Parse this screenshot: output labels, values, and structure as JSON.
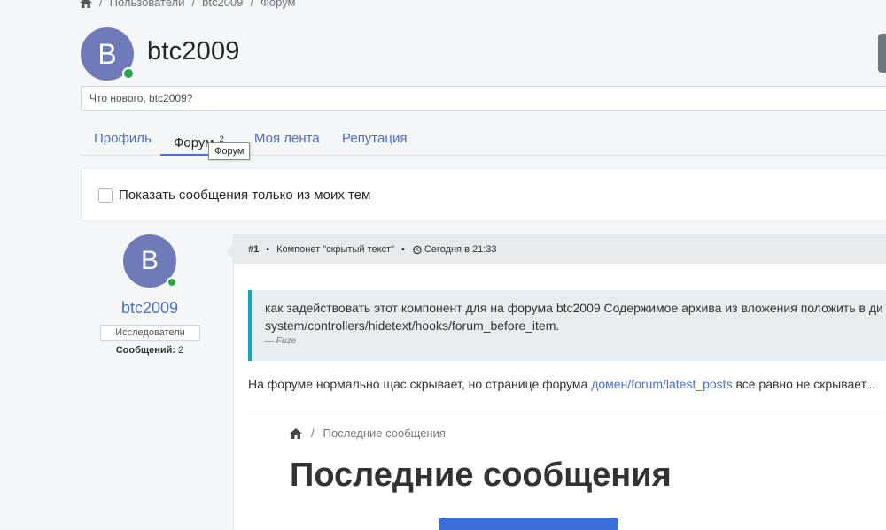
{
  "breadcrumb": {
    "home_icon": "home-icon",
    "items": [
      "Пользователи",
      "btc2009",
      "Форум"
    ]
  },
  "profile": {
    "avatar_letter": "B",
    "name": "btc2009",
    "status_placeholder": "Что нового, btc2009?"
  },
  "tabs": [
    {
      "label": "Профиль"
    },
    {
      "label": "Форум",
      "count": "2"
    },
    {
      "label": "Моя лента"
    },
    {
      "label": "Репутация"
    }
  ],
  "tooltip": "Форум",
  "filter": {
    "label": "Показать сообщения только из моих тем",
    "checked": false
  },
  "poster": {
    "avatar_letter": "B",
    "name": "btc2009",
    "group": "Исследователи",
    "messages_label": "Сообщений:",
    "messages_count": "2"
  },
  "post": {
    "number": "#1",
    "topic": "Компонет \"скрытый текст\"",
    "time": "Сегодня в 21:33",
    "quote_line1": "как задействовать этот компонент для на форума  btc2009 Содержимое архива из вложения положить в ди",
    "quote_line2": "system/controllers/hidetext/hooks/forum_before_item.",
    "quote_author": "— Fuze",
    "text_before": "На форуме нормально щас скрывает, но странице форума ",
    "link": "домен/forum/latest_posts",
    "text_after": " все равно не скрывает..."
  },
  "embedded": {
    "breadcrumb_item": "Последние сообщения",
    "title": "Последние сообщения"
  },
  "colors": {
    "accent": "#4c6ed1",
    "avatar": "#6f7bb8",
    "online": "#28a745",
    "quote_border": "#17a2b8"
  }
}
